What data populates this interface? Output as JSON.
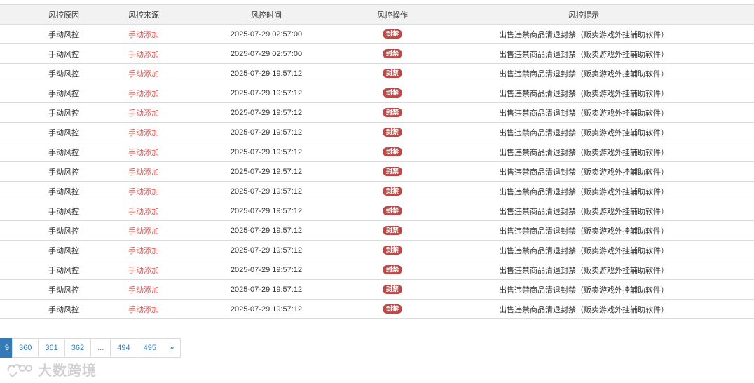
{
  "table": {
    "headers": {
      "reason": "风控原因",
      "source": "风控来源",
      "time": "风控时间",
      "action": "风控操作",
      "hint": "风控提示"
    },
    "rows": [
      {
        "reason": "手动风控",
        "source": "手动添加",
        "time": "2025-07-29 02:57:00",
        "action": "封禁",
        "hint": "出售违禁商品清退封禁（贩卖游戏外挂辅助软件）"
      },
      {
        "reason": "手动风控",
        "source": "手动添加",
        "time": "2025-07-29 02:57:00",
        "action": "封禁",
        "hint": "出售违禁商品清退封禁（贩卖游戏外挂辅助软件）"
      },
      {
        "reason": "手动风控",
        "source": "手动添加",
        "time": "2025-07-29 19:57:12",
        "action": "封禁",
        "hint": "出售违禁商品清退封禁（贩卖游戏外挂辅助软件）"
      },
      {
        "reason": "手动风控",
        "source": "手动添加",
        "time": "2025-07-29 19:57:12",
        "action": "封禁",
        "hint": "出售违禁商品清退封禁（贩卖游戏外挂辅助软件）"
      },
      {
        "reason": "手动风控",
        "source": "手动添加",
        "time": "2025-07-29 19:57:12",
        "action": "封禁",
        "hint": "出售违禁商品清退封禁（贩卖游戏外挂辅助软件）"
      },
      {
        "reason": "手动风控",
        "source": "手动添加",
        "time": "2025-07-29 19:57:12",
        "action": "封禁",
        "hint": "出售违禁商品清退封禁（贩卖游戏外挂辅助软件）"
      },
      {
        "reason": "手动风控",
        "source": "手动添加",
        "time": "2025-07-29 19:57:12",
        "action": "封禁",
        "hint": "出售违禁商品清退封禁（贩卖游戏外挂辅助软件）"
      },
      {
        "reason": "手动风控",
        "source": "手动添加",
        "time": "2025-07-29 19:57:12",
        "action": "封禁",
        "hint": "出售违禁商品清退封禁（贩卖游戏外挂辅助软件）"
      },
      {
        "reason": "手动风控",
        "source": "手动添加",
        "time": "2025-07-29 19:57:12",
        "action": "封禁",
        "hint": "出售违禁商品清退封禁（贩卖游戏外挂辅助软件）"
      },
      {
        "reason": "手动风控",
        "source": "手动添加",
        "time": "2025-07-29 19:57:12",
        "action": "封禁",
        "hint": "出售违禁商品清退封禁（贩卖游戏外挂辅助软件）"
      },
      {
        "reason": "手动风控",
        "source": "手动添加",
        "time": "2025-07-29 19:57:12",
        "action": "封禁",
        "hint": "出售违禁商品清退封禁（贩卖游戏外挂辅助软件）"
      },
      {
        "reason": "手动风控",
        "source": "手动添加",
        "time": "2025-07-29 19:57:12",
        "action": "封禁",
        "hint": "出售违禁商品清退封禁（贩卖游戏外挂辅助软件）"
      },
      {
        "reason": "手动风控",
        "source": "手动添加",
        "time": "2025-07-29 19:57:12",
        "action": "封禁",
        "hint": "出售违禁商品清退封禁（贩卖游戏外挂辅助软件）"
      },
      {
        "reason": "手动风控",
        "source": "手动添加",
        "time": "2025-07-29 19:57:12",
        "action": "封禁",
        "hint": "出售违禁商品清退封禁（贩卖游戏外挂辅助软件）"
      },
      {
        "reason": "手动风控",
        "source": "手动添加",
        "time": "2025-07-29 19:57:12",
        "action": "封禁",
        "hint": "出售违禁商品清退封禁（贩卖游戏外挂辅助软件）"
      }
    ]
  },
  "pagination": {
    "current": "9",
    "pages": [
      "360",
      "361",
      "362"
    ],
    "ellipsis": "...",
    "tail_pages": [
      "494",
      "495"
    ],
    "next": "»"
  },
  "watermark": {
    "text": "大数跨境"
  },
  "colors": {
    "source_red": "#d9534f",
    "badge_bg": "#b94a48",
    "link_blue": "#337ab7",
    "header_bg": "#f2f2f2"
  }
}
